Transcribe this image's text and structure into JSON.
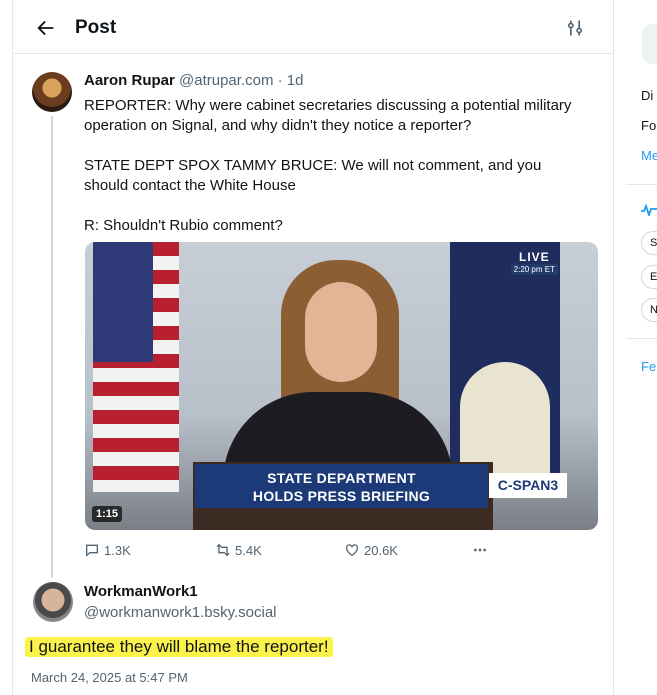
{
  "header": {
    "title": "Post"
  },
  "post": {
    "author_name": "Aaron Rupar",
    "author_handle": "@atrupar.com",
    "separator": "·",
    "time": "1d",
    "paragraphs": [
      "REPORTER: Why were cabinet secretaries discussing a potential military operation on Signal, and why didn't they notice a reporter?",
      "STATE DEPT SPOX TAMMY BRUCE: We will not comment, and you should contact the White House",
      "R: Shouldn't Rubio comment?"
    ],
    "video": {
      "live_label": "LIVE",
      "live_time": "2:20 pm ET",
      "banner_line1": "STATE DEPARTMENT",
      "banner_line2": "HOLDS PRESS BRIEFING",
      "network": "C-SPAN3",
      "duration": "1:15"
    },
    "actions": {
      "replies": "1.3K",
      "reposts": "5.4K",
      "likes": "20.6K"
    }
  },
  "reply": {
    "author_name": "WorkmanWork1",
    "author_handle": "@workmanwork1.bsky.social",
    "text": "I guarantee they will blame the reporter!",
    "date": "March 24, 2025 at 5:47 PM"
  },
  "right_panel": {
    "line1": "Di",
    "line2": "Fo",
    "line3": "Me",
    "pills": [
      "S",
      "E",
      "N"
    ],
    "footer": "Fe"
  },
  "colors": {
    "accent": "#1d9bf0",
    "highlight": "#fbf24a",
    "muted": "#536471"
  }
}
